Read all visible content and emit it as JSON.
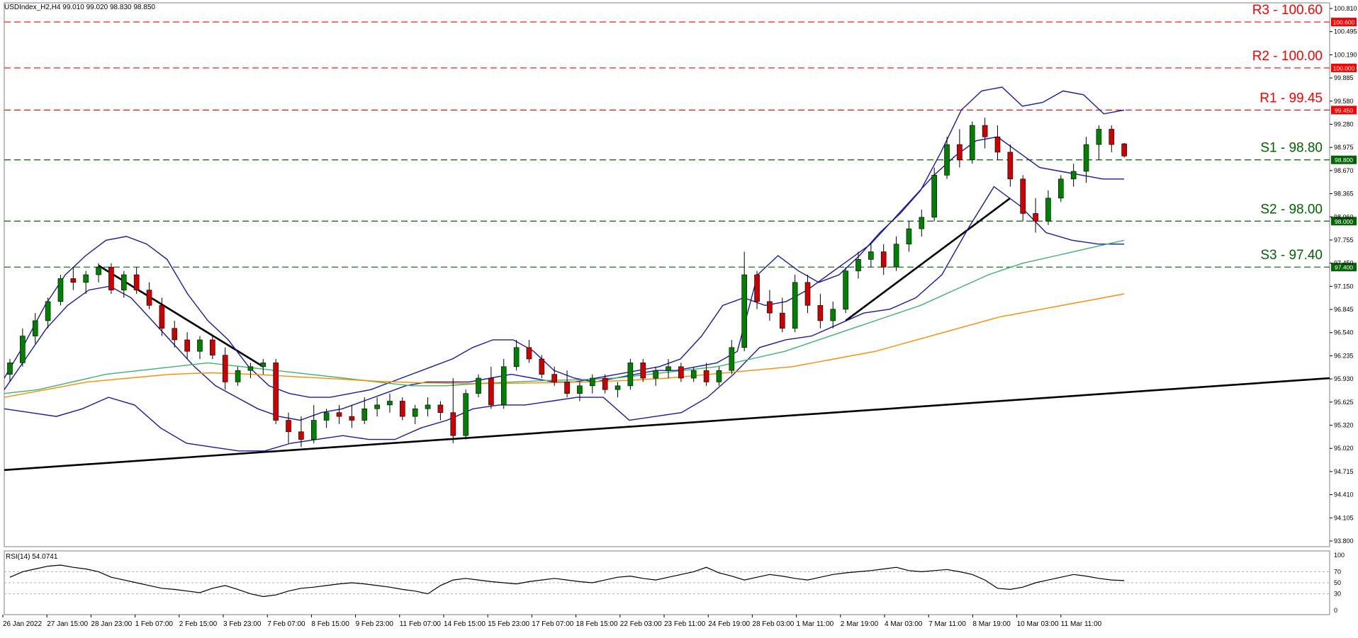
{
  "window": {
    "symbol_info": "USDIndex_H2,H4  99.010 99.020 98.830 98.850"
  },
  "colors": {
    "bull": "#008000",
    "bear": "#cc0000",
    "resistance": "#ff0000",
    "support": "#006400",
    "bollinger": "#1a1aa6",
    "sma_green": "#3cb371",
    "sma_orange": "#ff8c00",
    "trendline": "#000000",
    "rsi_line": "#000000"
  },
  "chart_data": {
    "type": "candlestick",
    "title": "USDIndex_H2,H4",
    "ohlc_header": "99.010 99.020 98.830 98.850",
    "ylim": [
      93.75,
      100.85
    ],
    "y_ticks": [
      "100.810",
      "100.495",
      "100.190",
      "99.885",
      "99.580",
      "99.280",
      "98.975",
      "98.670",
      "98.365",
      "98.060",
      "97.755",
      "97.450",
      "97.150",
      "96.845",
      "96.540",
      "96.235",
      "95.930",
      "95.625",
      "95.320",
      "95.020",
      "94.715",
      "94.410",
      "94.105",
      "93.800"
    ],
    "x_labels": [
      "26 Jan 2022",
      "27 Jan 15:00",
      "28 Jan 23:00",
      "1 Feb 07:00",
      "2 Feb 15:00",
      "3 Feb 23:00",
      "7 Feb 07:00",
      "8 Feb 15:00",
      "9 Feb 23:00",
      "11 Feb 07:00",
      "14 Feb 15:00",
      "15 Feb 23:00",
      "17 Feb 07:00",
      "18 Feb 15:00",
      "22 Feb 03:00",
      "23 Feb 11:00",
      "24 Feb 19:00",
      "28 Feb 03:00",
      "1 Mar 11:00",
      "2 Mar 19:00",
      "4 Mar 03:00",
      "7 Mar 11:00",
      "8 Mar 19:00",
      "10 Mar 03:00",
      "11 Mar 11:00"
    ],
    "levels": [
      {
        "label": "R3 - 100.60",
        "value": 100.6,
        "tag": "100.600",
        "kind": "resistance"
      },
      {
        "label": "R2 - 100.00",
        "value": 100.0,
        "tag": "100.000",
        "kind": "resistance"
      },
      {
        "label": "R1 - 99.45",
        "value": 99.45,
        "tag": "99.450",
        "kind": "resistance"
      },
      {
        "label": "S1 - 98.80",
        "value": 98.8,
        "tag": "98.800",
        "kind": "support"
      },
      {
        "label": "S2 - 98.00",
        "value": 98.0,
        "tag": "98.000",
        "kind": "support"
      },
      {
        "label": "S3 - 97.40",
        "value": 97.4,
        "tag": "97.400",
        "kind": "support"
      }
    ],
    "candles": [
      [
        96.0,
        96.2,
        95.9,
        96.15
      ],
      [
        96.15,
        96.6,
        96.1,
        96.5
      ],
      [
        96.5,
        96.8,
        96.4,
        96.7
      ],
      [
        96.7,
        97.0,
        96.6,
        96.95
      ],
      [
        96.95,
        97.3,
        96.9,
        97.25
      ],
      [
        97.25,
        97.4,
        97.1,
        97.2
      ],
      [
        97.2,
        97.35,
        97.05,
        97.3
      ],
      [
        97.3,
        97.45,
        97.2,
        97.4
      ],
      [
        97.4,
        97.45,
        97.05,
        97.1
      ],
      [
        97.1,
        97.35,
        97.0,
        97.3
      ],
      [
        97.3,
        97.4,
        97.05,
        97.1
      ],
      [
        97.1,
        97.2,
        96.85,
        96.9
      ],
      [
        96.9,
        97.0,
        96.5,
        96.6
      ],
      [
        96.6,
        96.7,
        96.35,
        96.45
      ],
      [
        96.45,
        96.55,
        96.2,
        96.3
      ],
      [
        96.3,
        96.5,
        96.2,
        96.45
      ],
      [
        96.45,
        96.5,
        96.2,
        96.25
      ],
      [
        96.25,
        96.35,
        95.8,
        95.9
      ],
      [
        95.9,
        96.1,
        95.85,
        96.05
      ],
      [
        96.05,
        96.15,
        95.95,
        96.1
      ],
      [
        96.1,
        96.2,
        96.0,
        96.15
      ],
      [
        96.15,
        96.2,
        95.35,
        95.4
      ],
      [
        95.4,
        95.5,
        95.1,
        95.25
      ],
      [
        95.25,
        95.45,
        95.05,
        95.15
      ],
      [
        95.15,
        95.6,
        95.1,
        95.4
      ],
      [
        95.4,
        95.55,
        95.3,
        95.5
      ],
      [
        95.5,
        95.6,
        95.35,
        95.45
      ],
      [
        95.45,
        95.6,
        95.3,
        95.4
      ],
      [
        95.4,
        95.7,
        95.35,
        95.55
      ],
      [
        95.55,
        95.7,
        95.45,
        95.6
      ],
      [
        95.6,
        95.75,
        95.5,
        95.65
      ],
      [
        95.65,
        95.7,
        95.4,
        95.45
      ],
      [
        95.45,
        95.6,
        95.35,
        95.55
      ],
      [
        95.55,
        95.7,
        95.45,
        95.6
      ],
      [
        95.6,
        95.65,
        95.4,
        95.5
      ],
      [
        95.5,
        95.95,
        95.1,
        95.2
      ],
      [
        95.2,
        95.8,
        95.15,
        95.75
      ],
      [
        95.75,
        96.0,
        95.7,
        95.95
      ],
      [
        95.95,
        96.1,
        95.55,
        95.6
      ],
      [
        95.6,
        96.2,
        95.55,
        96.1
      ],
      [
        96.1,
        96.45,
        96.05,
        96.35
      ],
      [
        96.35,
        96.45,
        96.15,
        96.2
      ],
      [
        96.2,
        96.25,
        95.95,
        96.0
      ],
      [
        96.0,
        96.1,
        95.85,
        95.9
      ],
      [
        95.9,
        96.05,
        95.7,
        95.75
      ],
      [
        95.75,
        95.9,
        95.65,
        95.85
      ],
      [
        95.85,
        96.0,
        95.75,
        95.95
      ],
      [
        95.95,
        96.0,
        95.75,
        95.8
      ],
      [
        95.8,
        95.9,
        95.7,
        95.85
      ],
      [
        95.85,
        96.2,
        95.8,
        96.15
      ],
      [
        96.15,
        96.2,
        95.9,
        95.95
      ],
      [
        95.95,
        96.1,
        95.85,
        96.05
      ],
      [
        96.05,
        96.2,
        95.95,
        96.1
      ],
      [
        96.1,
        96.15,
        95.9,
        95.95
      ],
      [
        95.95,
        96.1,
        95.9,
        96.05
      ],
      [
        96.05,
        96.15,
        95.85,
        95.9
      ],
      [
        95.9,
        96.1,
        95.85,
        96.05
      ],
      [
        96.05,
        96.45,
        96.0,
        96.35
      ],
      [
        96.35,
        97.6,
        96.3,
        97.3
      ],
      [
        97.3,
        97.35,
        96.85,
        96.95
      ],
      [
        96.95,
        97.1,
        96.7,
        96.8
      ],
      [
        96.8,
        97.0,
        96.55,
        96.6
      ],
      [
        96.6,
        97.3,
        96.55,
        97.2
      ],
      [
        97.2,
        97.3,
        96.8,
        96.9
      ],
      [
        96.9,
        97.05,
        96.6,
        96.7
      ],
      [
        96.7,
        96.95,
        96.6,
        96.85
      ],
      [
        96.85,
        97.4,
        96.8,
        97.35
      ],
      [
        97.35,
        97.6,
        97.25,
        97.5
      ],
      [
        97.5,
        97.7,
        97.4,
        97.6
      ],
      [
        97.6,
        97.7,
        97.3,
        97.4
      ],
      [
        97.4,
        97.8,
        97.35,
        97.7
      ],
      [
        97.7,
        98.0,
        97.6,
        97.9
      ],
      [
        97.9,
        98.15,
        97.8,
        98.05
      ],
      [
        98.05,
        98.7,
        98.0,
        98.6
      ],
      [
        98.6,
        99.1,
        98.55,
        99.0
      ],
      [
        99.0,
        99.2,
        98.7,
        98.8
      ],
      [
        98.8,
        99.3,
        98.75,
        99.25
      ],
      [
        99.25,
        99.35,
        98.95,
        99.1
      ],
      [
        99.1,
        99.25,
        98.8,
        98.9
      ],
      [
        98.9,
        99.0,
        98.45,
        98.55
      ],
      [
        98.55,
        98.6,
        98.0,
        98.1
      ],
      [
        98.1,
        98.3,
        97.85,
        98.0
      ],
      [
        98.0,
        98.4,
        97.95,
        98.3
      ],
      [
        98.3,
        98.6,
        98.25,
        98.55
      ],
      [
        98.55,
        98.75,
        98.45,
        98.65
      ],
      [
        98.65,
        99.1,
        98.5,
        99.0
      ],
      [
        99.0,
        99.25,
        98.8,
        99.2
      ],
      [
        99.2,
        99.25,
        98.9,
        99.0
      ],
      [
        99.01,
        99.02,
        98.83,
        98.85
      ]
    ],
    "indicators": {
      "bollinger_upper": [
        95.95,
        96.4,
        96.9,
        97.3,
        97.55,
        97.75,
        97.8,
        97.7,
        97.5,
        97.05,
        96.7,
        96.45,
        96.1,
        95.85,
        95.75,
        95.7,
        95.7,
        95.75,
        95.8,
        95.9,
        96.0,
        96.1,
        96.2,
        96.35,
        96.45,
        96.45,
        96.3,
        96.05,
        95.95,
        95.9,
        95.95,
        96.0,
        96.05,
        96.05,
        96.1,
        96.15,
        96.3,
        97.3,
        97.55,
        97.35,
        97.2,
        97.3,
        97.55,
        97.85,
        98.1,
        98.4,
        98.9,
        99.45,
        99.7,
        99.75,
        99.5,
        99.55,
        99.7,
        99.65,
        99.4,
        99.45
      ],
      "bollinger_middle": [
        95.8,
        96.2,
        96.6,
        96.9,
        97.1,
        97.15,
        97.0,
        96.7,
        96.4,
        96.1,
        95.85,
        95.7,
        95.55,
        95.45,
        95.4,
        95.5,
        95.55,
        95.65,
        95.75,
        95.85,
        95.9,
        95.9,
        95.9,
        95.95,
        96.0,
        95.95,
        95.9,
        95.9,
        95.95,
        96.0,
        96.05,
        96.1,
        96.2,
        96.5,
        96.9,
        97.0,
        96.9,
        96.95,
        97.1,
        97.3,
        97.5,
        97.7,
        98.0,
        98.3,
        98.6,
        98.85,
        99.05,
        99.1,
        98.9,
        98.7,
        98.65,
        98.6,
        98.55,
        98.55
      ],
      "bollinger_lower": [
        95.55,
        95.5,
        95.45,
        95.55,
        95.7,
        95.6,
        95.3,
        95.1,
        95.05,
        95.0,
        95.0,
        95.1,
        95.15,
        95.2,
        95.15,
        95.15,
        95.3,
        95.4,
        95.55,
        95.6,
        95.6,
        95.65,
        95.7,
        95.7,
        95.4,
        95.45,
        95.5,
        95.7,
        96.0,
        96.35,
        96.45,
        96.5,
        96.65,
        96.8,
        96.85,
        97.0,
        97.3,
        97.9,
        98.45,
        98.2,
        97.85,
        97.75,
        97.7,
        97.7
      ],
      "sma_100_green": [
        95.75,
        95.8,
        95.9,
        96.0,
        96.05,
        96.1,
        96.15,
        96.1,
        96.05,
        96.0,
        95.95,
        95.9,
        95.85,
        95.85,
        95.88,
        95.9,
        95.92,
        95.93,
        95.95,
        96.0,
        96.05,
        96.1,
        96.2,
        96.3,
        96.45,
        96.6,
        96.75,
        96.9,
        97.1,
        97.3,
        97.45,
        97.55,
        97.65,
        97.75
      ],
      "sma_200_orange": [
        95.7,
        95.8,
        95.9,
        95.95,
        96.0,
        96.02,
        96.0,
        95.97,
        95.94,
        95.91,
        95.89,
        95.88,
        95.88,
        95.89,
        95.9,
        95.92,
        95.95,
        96.0,
        96.05,
        96.1,
        96.2,
        96.3,
        96.45,
        96.6,
        96.75,
        96.85,
        96.95,
        97.05
      ]
    },
    "trendlines": [
      {
        "from": [
          0,
          94.75
        ],
        "to": [
          1,
          95.95
        ]
      },
      {
        "name": "descending",
        "from_idx": 7,
        "from_val": 97.42,
        "to_idx": 20,
        "to_val": 96.1
      },
      {
        "name": "ascending",
        "from_idx": 66,
        "from_val": 96.7,
        "to_idx": 79,
        "to_val": 98.3
      }
    ],
    "rsi": {
      "label": "RSI(14) 54.0741",
      "ylim": [
        0,
        100
      ],
      "ticks": [
        "100",
        "70",
        "50",
        "30",
        "0"
      ],
      "values": [
        60,
        70,
        75,
        80,
        82,
        78,
        75,
        70,
        60,
        55,
        50,
        45,
        40,
        38,
        35,
        32,
        40,
        45,
        38,
        30,
        25,
        28,
        35,
        40,
        42,
        45,
        48,
        50,
        48,
        45,
        42,
        38,
        35,
        30,
        45,
        55,
        58,
        55,
        52,
        50,
        48,
        52,
        55,
        58,
        55,
        52,
        50,
        55,
        60,
        62,
        58,
        55,
        60,
        65,
        70,
        78,
        68,
        62,
        55,
        60,
        65,
        62,
        58,
        55,
        60,
        65,
        68,
        70,
        72,
        75,
        78,
        72,
        70,
        72,
        74,
        70,
        65,
        55,
        40,
        38,
        42,
        50,
        55,
        60,
        65,
        62,
        58,
        55,
        54
      ]
    }
  }
}
